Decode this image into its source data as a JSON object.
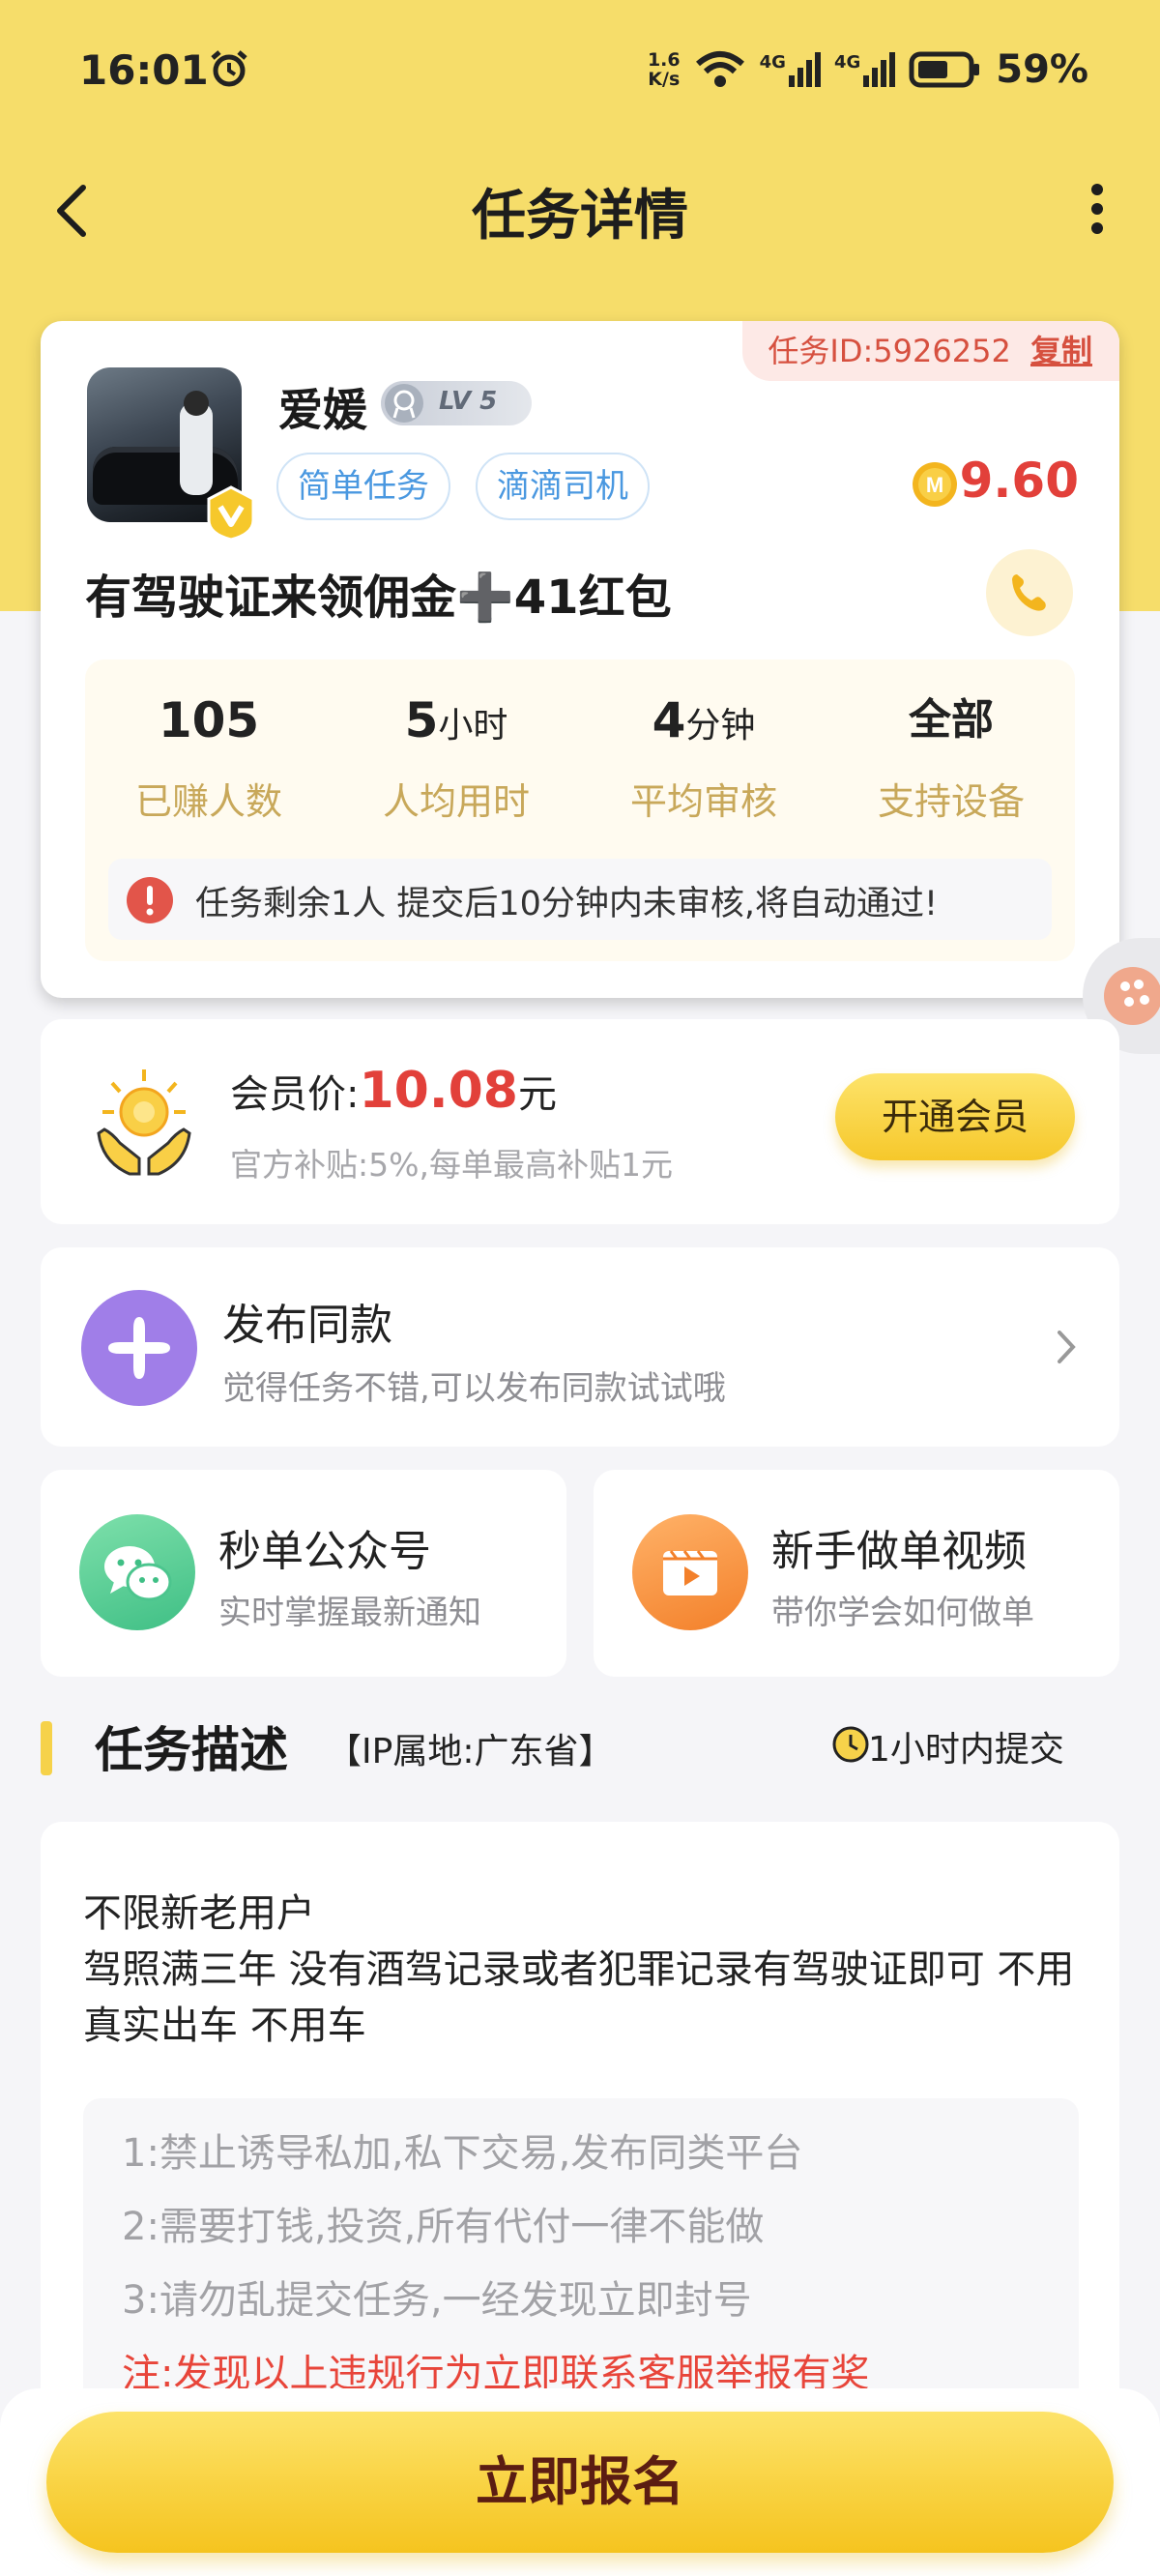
{
  "status_bar": {
    "time": "16:01",
    "net_speed_top": "1.6",
    "net_speed_bottom": "K/s",
    "sig1": "4G",
    "sig2": "4G",
    "battery": "59%"
  },
  "nav": {
    "title": "任务详情"
  },
  "task": {
    "id_label": "任务ID:5926252",
    "copy_label": "复制",
    "username": "爱媛",
    "level": "LV 5",
    "tags": [
      "简单任务",
      "滴滴司机"
    ],
    "reward": "9.60",
    "title": "有驾驶证来领佣金➕41红包"
  },
  "stats": [
    {
      "value": "105",
      "unit": "",
      "label": "已赚人数"
    },
    {
      "value": "5",
      "unit": "小时",
      "label": "人均用时"
    },
    {
      "value": "4",
      "unit": "分钟",
      "label": "平均审核"
    },
    {
      "value": "全部",
      "unit": "",
      "label": "支持设备"
    }
  ],
  "notice": "任务剩余1人  提交后10分钟内未审核,将自动通过!",
  "member": {
    "price_label": "会员价:",
    "price": "10.08",
    "price_unit": "元",
    "sub": "官方补贴:5%,每单最高补贴1元",
    "button": "开通会员"
  },
  "publish": {
    "title": "发布同款",
    "sub": "觉得任务不错,可以发布同款试试哦"
  },
  "wechat": {
    "title": "秒单公众号",
    "sub": "实时掌握最新通知"
  },
  "video": {
    "title": "新手做单视频",
    "sub": "带你学会如何做单"
  },
  "section": {
    "title": "任务描述",
    "ip": "【IP属地:广东省】",
    "submit_time": "1小时内提交"
  },
  "description": {
    "line1": "不限新老用户",
    "line2": "驾照满三年 没有酒驾记录或者犯罪记录有驾驶证即可   不用真实出车  不用车",
    "rules": [
      "1:禁止诱导私加,私下交易,发布同类平台",
      "2:需要打钱,投资,所有代付一律不能做",
      "3:请勿乱提交任务,一经发现立即封号"
    ],
    "warning": "注:发现以上违规行为立即联系客服举报有奖"
  },
  "bottom": {
    "signup": "立即报名"
  },
  "colors": {
    "brand_yellow": "#f6dd6a",
    "price_red": "#e2403a",
    "tag_blue": "#4a98e0"
  }
}
